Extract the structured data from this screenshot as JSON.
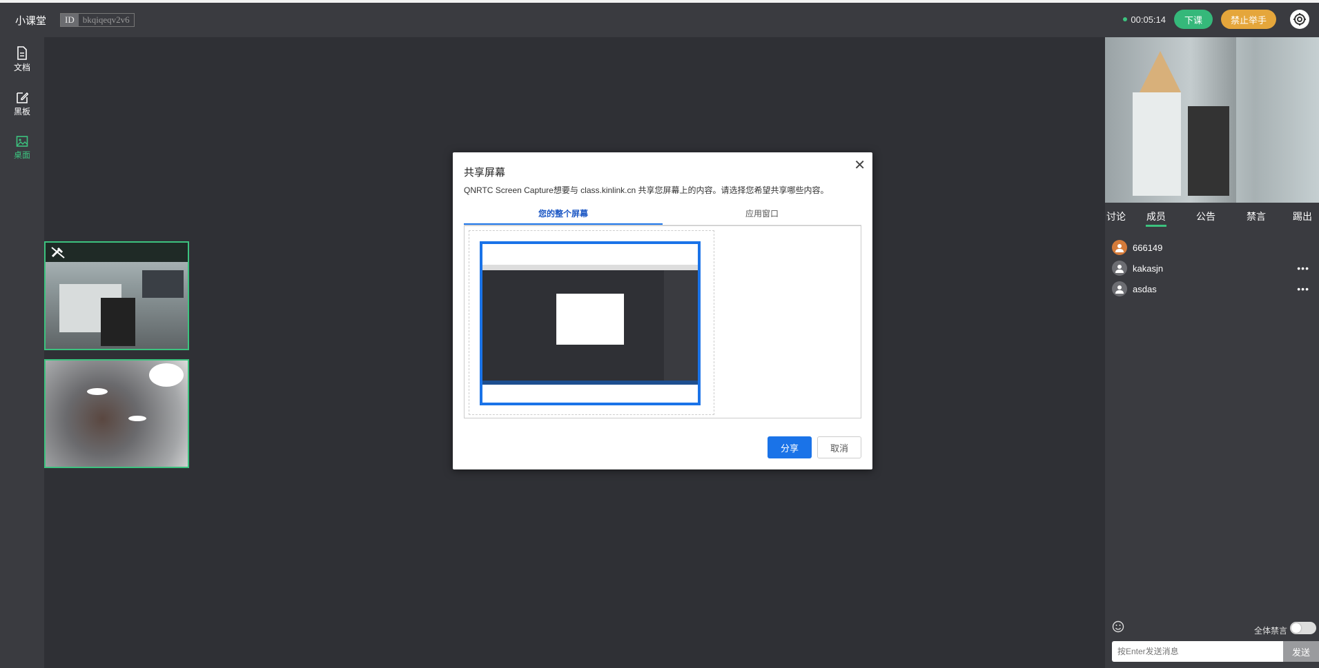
{
  "header": {
    "app_title": "小课堂",
    "id_tag": "ID",
    "room_id": "bkqiqeqv2v6",
    "timer": "00:05:14",
    "end_class_label": "下课",
    "ban_hand_label": "禁止举手",
    "settings_icon": "gear-icon"
  },
  "sidebar": {
    "items": [
      {
        "label": "文档",
        "icon": "document-icon"
      },
      {
        "label": "黑板",
        "icon": "edit-icon"
      },
      {
        "label": "桌面",
        "icon": "image-icon"
      }
    ]
  },
  "right_panel": {
    "tabs": [
      {
        "label": "讨论"
      },
      {
        "label": "成员"
      },
      {
        "label": "公告"
      },
      {
        "label": "禁言"
      },
      {
        "label": "踢出"
      }
    ],
    "members": [
      {
        "name": "666149",
        "role": "teacher"
      },
      {
        "name": "kakasjn",
        "more": "•••"
      },
      {
        "name": "asdas",
        "more": "•••"
      }
    ],
    "mute_all_label": "全体禁言",
    "chat_placeholder": "按Enter发送消息",
    "send_label": "发送"
  },
  "dialog": {
    "title": "共享屏幕",
    "description": "QNRTC Screen Capture想要与 class.kinlink.cn 共享您屏幕上的内容。请选择您希望共享哪些内容。",
    "tabs": [
      {
        "label": "您的整个屏幕"
      },
      {
        "label": "应用窗口"
      }
    ],
    "share_label": "分享",
    "cancel_label": "取消",
    "close_symbol": "✕"
  },
  "colors": {
    "accent_green": "#3cc37f",
    "accent_orange": "#e5a63b",
    "dialog_blue": "#1a73e8"
  }
}
